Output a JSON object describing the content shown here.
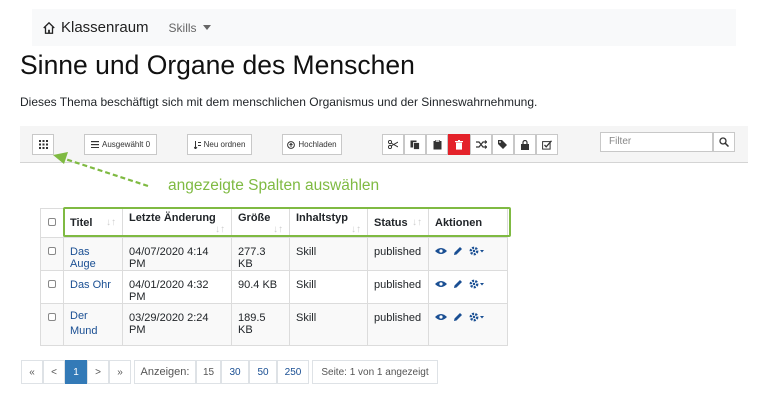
{
  "navbar": {
    "brand": "Klassenraum",
    "menu_skills": "Skills"
  },
  "page": {
    "title": "Sinne und Organe des Menschen",
    "description": "Dieses Thema beschäftigt sich mit dem menschlichen Organismus und der Sinneswahrnehmung."
  },
  "toolbar": {
    "selected_label": "Ausgewählt 0",
    "reorder_label": "Neu ordnen",
    "upload_label": "Hochladen",
    "filter_placeholder": "Filter",
    "delete_color": "#e4222a"
  },
  "hint": {
    "text": "angezeigte Spalten auswählen",
    "color": "#7fba42"
  },
  "table": {
    "headers": {
      "title": "Titel",
      "last_modified": "Letzte Änderung",
      "size": "Größe",
      "content_type": "Inhaltstyp",
      "status": "Status",
      "actions": "Aktionen"
    },
    "rows": [
      {
        "title": "Das Auge",
        "modified": "04/07/2020 4:14 PM",
        "size": "277.3 KB",
        "type": "Skill",
        "status": "published"
      },
      {
        "title": "Das Ohr",
        "modified": "04/01/2020 4:32 PM",
        "size": "90.4 KB",
        "type": "Skill",
        "status": "published"
      },
      {
        "title": "Der Mund",
        "modified": "03/29/2020 2:24 PM",
        "size": "189.5 KB",
        "type": "Skill",
        "status": "published"
      }
    ]
  },
  "pagination": {
    "first": "«",
    "prev": "<",
    "current": "1",
    "next": ">",
    "last": "»",
    "show_label": "Anzeigen:",
    "sizes": [
      "15",
      "30",
      "50",
      "250"
    ],
    "page_info": "Seite: 1 von 1 angezeigt"
  }
}
